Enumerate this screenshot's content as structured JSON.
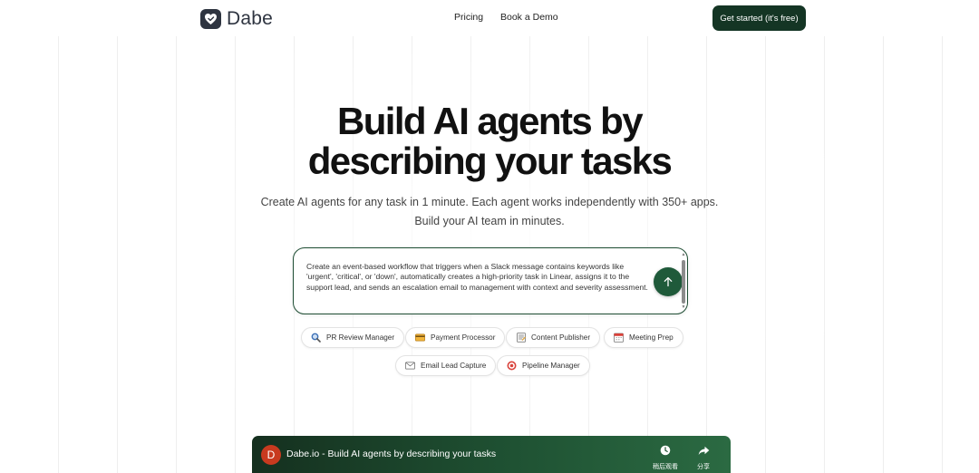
{
  "brand": {
    "name": "Dabe"
  },
  "nav": {
    "pricing": "Pricing",
    "demo": "Book a Demo",
    "cta": "Get started (it's free)"
  },
  "hero": {
    "headline_line1": "Build AI agents by",
    "headline_line2": "describing your tasks",
    "sub_line1": "Create AI agents for any task in 1 minute. Each agent works independently with 350+ apps.",
    "sub_line2": "Build your AI team in minutes."
  },
  "prompt": {
    "text": "Create an event-based workflow that triggers when a Slack message contains keywords like 'urgent', 'critical', or 'down', automatically creates a high-priority task in Linear, assigns it to the support lead, and sends an escalation email to management with context and severity assessment."
  },
  "chips": [
    {
      "label": "PR Review Manager",
      "icon": "magnifier-icon"
    },
    {
      "label": "Payment Processor",
      "icon": "credit-card-icon"
    },
    {
      "label": "Content Publisher",
      "icon": "document-icon"
    },
    {
      "label": "Meeting Prep",
      "icon": "calendar-icon"
    },
    {
      "label": "Email Lead Capture",
      "icon": "envelope-icon"
    },
    {
      "label": "Pipeline Manager",
      "icon": "target-icon"
    }
  ],
  "video": {
    "avatar_letter": "D",
    "title": "Dabe.io - Build AI agents by describing your tasks",
    "watch_later": "稍后观看",
    "share": "分享"
  },
  "colors": {
    "accent": "#143524",
    "send_button": "#1f5a3a",
    "avatar": "#c83a1f"
  }
}
